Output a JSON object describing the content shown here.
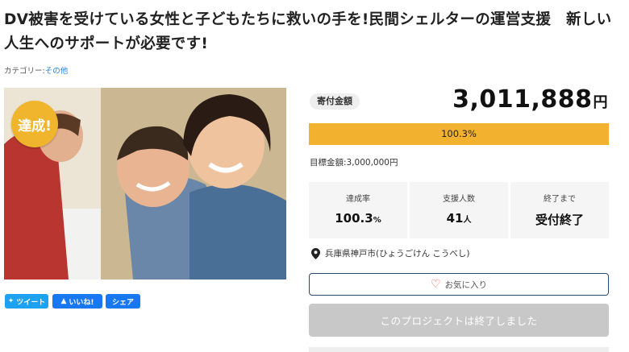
{
  "project": {
    "title": "DV被害を受けている女性と子どもたちに救いの手を!民間シェルターの運営支援　新しい人生へのサポートが必要です!",
    "category_label": "カテゴリー:",
    "category_value": "その他",
    "badge": "達成!"
  },
  "social": {
    "tweet": "ツイート",
    "like": "いいね!",
    "share": "シェア"
  },
  "funding": {
    "tag": "寄付金額",
    "amount": "3,011,888",
    "amount_unit": "円",
    "progress_label": "100.3%",
    "progress_percent": 100.3,
    "target_text": "目標金額:3,000,000円"
  },
  "stats": [
    {
      "label": "達成率",
      "value": "100.3",
      "unit": "%"
    },
    {
      "label": "支援人数",
      "value": "41",
      "unit": "人"
    },
    {
      "label": "終了まで",
      "value": "受付終了",
      "unit": ""
    }
  ],
  "location": "兵庫県神戸市(ひょうごけん こうべし)",
  "favorite_label": "お気に入り",
  "ended_label": "このプロジェクトは終了しました",
  "colors": {
    "accent": "#f2b12f",
    "twitter": "#1da1f2",
    "facebook": "#1877f2",
    "heart": "#e2574c"
  }
}
